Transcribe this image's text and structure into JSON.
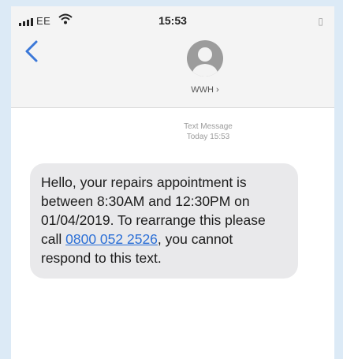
{
  "status_bar": {
    "carrier": "EE",
    "time": "15:53"
  },
  "contact": {
    "name": "WWH",
    "chevron": "›"
  },
  "thread": {
    "message_type": "Text Message",
    "timestamp": "Today 15:53"
  },
  "message": {
    "text_before_link": "Hello, your repairs appointment is between 8:30AM and 12:30PM on 01/04/2019. To rearrange this please call ",
    "phone_link": "0800 052 2526",
    "text_after_link": ", you cannot respond to this text."
  },
  "colors": {
    "link": "#2b6fd6",
    "back_chevron": "#3b78d8",
    "bubble": "#e9e9eb"
  },
  "icons": [
    "signal-icon",
    "wifi-icon",
    "back-chevron-icon",
    "contact-avatar-icon"
  ]
}
